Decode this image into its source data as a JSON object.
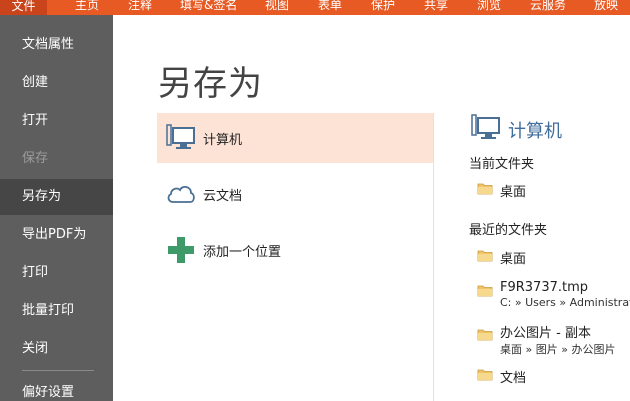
{
  "ribbon": {
    "tabs": [
      "文件",
      "主页",
      "注释",
      "填写&签名",
      "视图",
      "表单",
      "保护",
      "共享",
      "浏览",
      "云服务",
      "放映"
    ]
  },
  "sidebar": {
    "items": [
      {
        "label": "文档属性"
      },
      {
        "label": "创建"
      },
      {
        "label": "打开"
      },
      {
        "label": "保存"
      },
      {
        "label": "另存为"
      },
      {
        "label": "导出PDF为"
      },
      {
        "label": "打印"
      },
      {
        "label": "批量打印"
      },
      {
        "label": "关闭"
      },
      {
        "label": "偏好设置"
      }
    ]
  },
  "main": {
    "title": "另存为",
    "locations": [
      {
        "label": "计算机",
        "icon": "computer-icon"
      },
      {
        "label": "云文档",
        "icon": "cloud-icon"
      },
      {
        "label": "添加一个位置",
        "icon": "plus-icon"
      }
    ]
  },
  "right": {
    "heading": "计算机",
    "current_label": "当前文件夹",
    "current_folder": "桌面",
    "recent_label": "最近的文件夹",
    "recent": [
      {
        "name": "桌面"
      },
      {
        "name": "F9R3737.tmp",
        "path": "C: » Users » Administrat"
      },
      {
        "name": "办公图片 - 副本",
        "path": "桌面 » 图片 » 办公图片"
      },
      {
        "name": "文档"
      }
    ]
  },
  "colors": {
    "ribbon": "#e85a24",
    "sidebar": "#5e5e5e",
    "selected_location": "#fde3d6",
    "heading_blue": "#3f6d9c",
    "plus_green": "#3f9a6a"
  }
}
